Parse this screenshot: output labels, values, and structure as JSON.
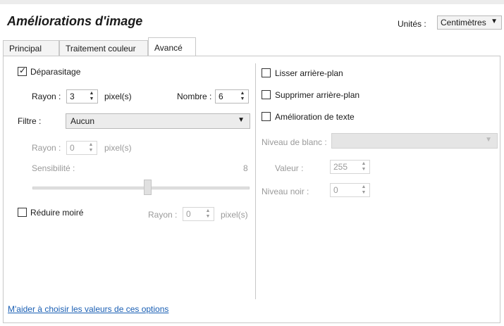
{
  "header": {
    "title": "Améliorations d'image",
    "units_label": "Unités :",
    "units_value": "Centimètres"
  },
  "tabs": [
    {
      "label": "Principal"
    },
    {
      "label": "Traitement couleur"
    },
    {
      "label": "Avancé"
    }
  ],
  "left": {
    "deparasitage_label": "Déparasitage",
    "deparasitage_checked": true,
    "rayon_label": "Rayon :",
    "rayon_value": "3",
    "pixel_unit": "pixel(s)",
    "nombre_label": "Nombre :",
    "nombre_value": "6",
    "filtre_label": "Filtre :",
    "filtre_value": "Aucun",
    "filtre_rayon_label": "Rayon :",
    "filtre_rayon_value": "0",
    "filtre_pixel_unit": "pixel(s)",
    "sensibilite_label": "Sensibilité :",
    "sensibilite_value": "8",
    "moire_label": "Réduire moiré",
    "moire_checked": false,
    "moire_rayon_label": "Rayon :",
    "moire_rayon_value": "0",
    "moire_pixel_unit": "pixel(s)"
  },
  "right": {
    "lisser_label": "Lisser arrière-plan",
    "supprimer_label": "Supprimer arrière-plan",
    "amelioration_label": "Amélioration de texte",
    "niveau_blanc_label": "Niveau de blanc :",
    "niveau_blanc_value": "",
    "valeur_label": "Valeur :",
    "valeur_value": "255",
    "niveau_noir_label": "Niveau noir :",
    "niveau_noir_value": "0"
  },
  "footer": {
    "help_link": "M'aider à choisir les valeurs de ces options"
  },
  "colors": {
    "link": "#1a5fb4",
    "disabled_text": "#9a9a9a"
  },
  "icons": [
    "check-icon",
    "chevron-down-icon",
    "spin-up-icon",
    "spin-down-icon"
  ]
}
